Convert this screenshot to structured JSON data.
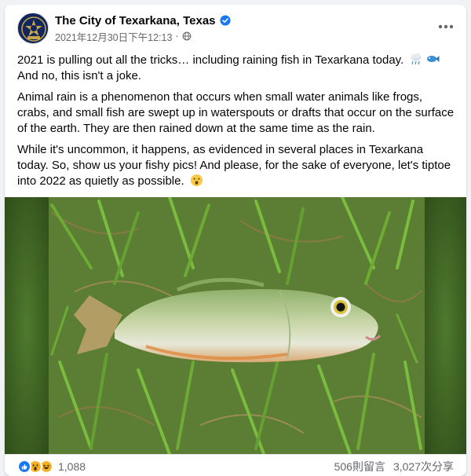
{
  "post": {
    "page_name": "The City of Texarkana, Texas",
    "timestamp": "2021年12月30日下午12:13",
    "separator": "·",
    "audience_icon": "globe-icon",
    "verified_icon": "verified-badge-icon",
    "more_icon": "more-options-icon"
  },
  "content": {
    "p1_line1": "2021 is pulling out all the tricks… including raining fish in Texarkana today.",
    "p1_line2": "And no, this isn't a joke.",
    "p2": "Animal rain is a phenomenon that occurs when small water animals like frogs, crabs, and small fish are swept up in waterspouts or drafts that occur on the surface of the earth. They are then rained down at the same time as the rain.",
    "p3": "While it's uncommon, it happens, as evidenced in several places in Texarkana today. So, show us your fishy pics! And please, for the sake of everyone, let's tiptoe into 2022 as quietly as possible.",
    "emoji_1": "cloud-rain-emoji",
    "emoji_2": "fish-emoji",
    "emoji_3": "hushed-face-emoji"
  },
  "media": {
    "subject": "fish-on-grass-photo"
  },
  "footer": {
    "reaction_icons": [
      "like-reaction-icon",
      "wow-reaction-icon",
      "haha-reaction-icon"
    ],
    "reaction_count": "1,088",
    "comments": "506則留言",
    "shares": "3,027次分享"
  },
  "colors": {
    "brand_blue": "#1877f2",
    "text_primary": "#050505",
    "text_secondary": "#65676b",
    "wow_yellow": "#f7b125"
  }
}
